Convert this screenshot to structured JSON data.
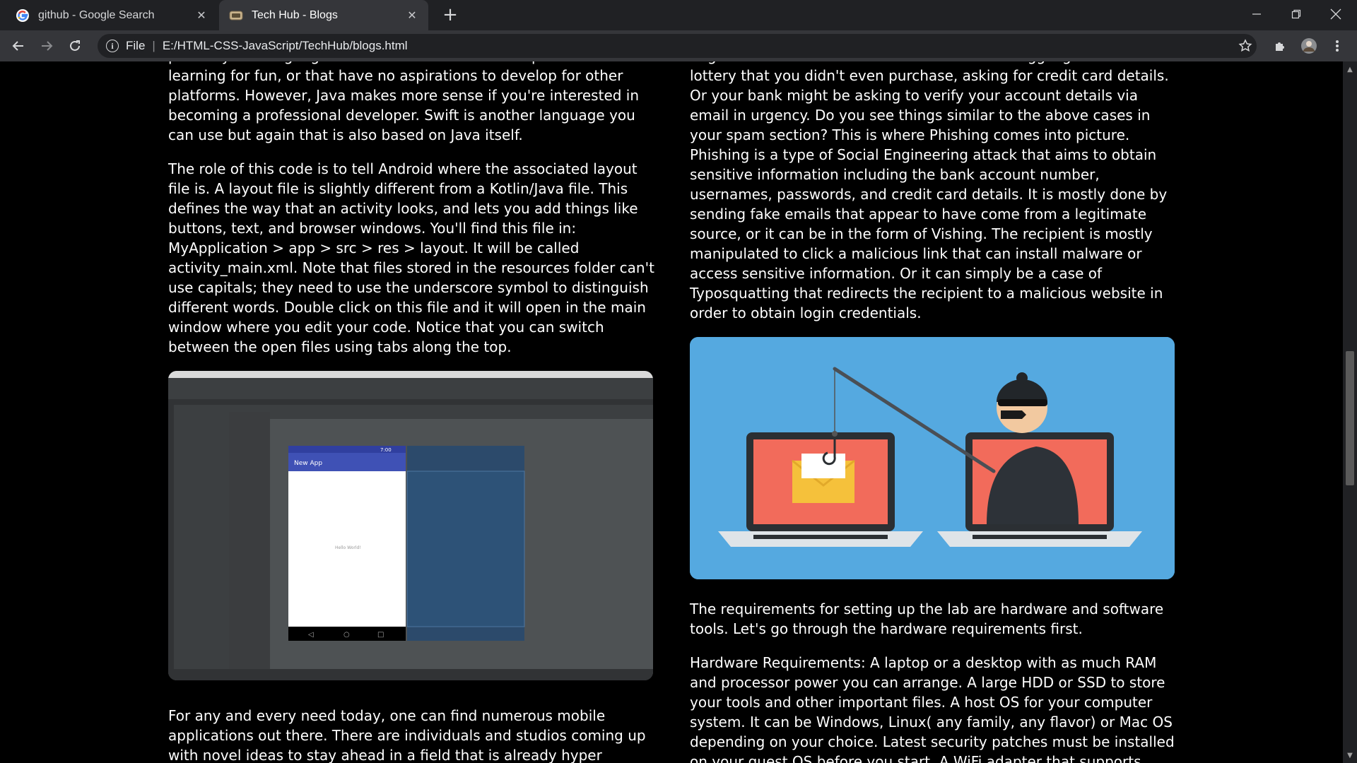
{
  "browser": {
    "tabs": [
      {
        "title": "github - Google Search",
        "favicon": "google-icon",
        "active": false
      },
      {
        "title": "Tech Hub - Blogs",
        "favicon": "site-icon",
        "active": true
      }
    ],
    "new_tab": "+",
    "address": {
      "scheme_label": "File",
      "url": "E:/HTML-CSS-JavaScript/TechHub/blogs.html"
    }
  },
  "content": {
    "left": {
      "para1": "probably the language of choice for Android developers that are learning for fun, or that have no aspirations to develop for other platforms. However, Java makes more sense if you're interested in becoming a professional developer. Swift is another language you can use but again that is also based on Java itself.",
      "para2": "The role of this code is to tell Android where the associated layout file is. A layout file is slightly different from a Kotlin/Java file. This defines the way that an activity looks, and lets you add things like buttons, text, and browser windows. You'll find this file in: MyApplication > app > src > res > layout. It will be called activity_main.xml. Note that files stored in the resources folder can't use capitals; they need to use the underscore symbol to distinguish different words. Double click on this file and it will open in the main window where you edit your code. Notice that you can switch between the open files using tabs along the top.",
      "screenshot": {
        "app_title": "New App",
        "time": "7:00",
        "hello": "Hello World!"
      },
      "para3": "For any and every need today, one can find numerous mobile applications out there. There are individuals and studios coming up with novel ideas to stay ahead in a field that is already hyper"
    },
    "right": {
      "para1": "might have won a brand new Audi or a mind-boggling amount in a lottery that you didn't even purchase, asking for credit card details. Or your bank might be asking to verify your account details via email in urgency. Do you see things similar to the above cases in your spam section? This is where Phishing comes into picture. Phishing is a type of Social Engineering attack that aims to obtain sensitive information including the bank account number, usernames, passwords, and credit card details. It is mostly done by sending fake emails that appear to have come from a legitimate source, or it can be in the form of Vishing. The recipient is mostly manipulated to click a malicious link that can install malware or access sensitive information. Or it can simply be a case of Typosquatting that redirects the recipient to a malicious website in order to obtain login credentials.",
      "para2": "The requirements for setting up the lab are hardware and software tools. Let's go through the hardware requirements first.",
      "para3": "Hardware Requirements: A laptop or a desktop with as much RAM and processor power you can arrange. A large HDD or SSD to store your tools and other important files. A host OS for your computer system. It can be Windows, Linux( any family, any flavor) or Mac OS depending on your choice. Latest security patches must be installed on your guest OS before you start. A WiFi adapter that supports"
    }
  },
  "colors": {
    "tabstrip": "#202124",
    "toolbar": "#35363a",
    "page_bg": "#000000",
    "phish_bg": "#55a9e0"
  }
}
